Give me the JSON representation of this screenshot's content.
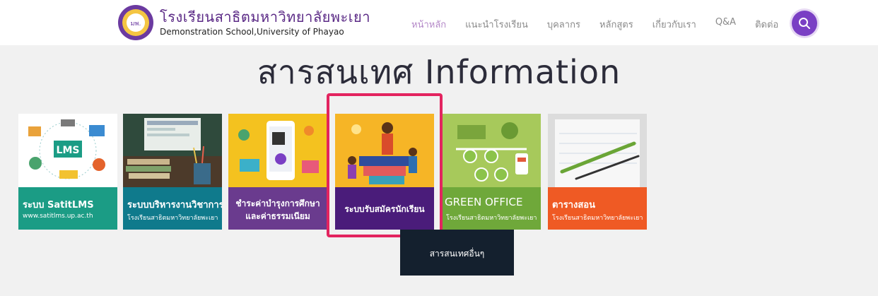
{
  "header": {
    "school_name_th": "โรงเรียนสาธิตมหาวิทยาลัยพะเยา",
    "school_name_en": "Demonstration School,University of Phayao",
    "seal_icon": "school-seal-icon",
    "seal_text": "มพ."
  },
  "nav": {
    "items": [
      "หน้าหลัก",
      "แนะนำโรงเรียน",
      "บุคลากร",
      "หลักสูตร",
      "เกี่ยวกับเรา",
      "Q&A",
      "ติดต่อ"
    ],
    "active_index": 0,
    "search_icon": "search-icon"
  },
  "page_title": "สารสนเทศ Information",
  "cards": [
    {
      "title": "ระบบ SatitLMS",
      "subtitle": "www.satitlms.up.ac.th",
      "caption_color": "#1b9c85"
    },
    {
      "title": "ระบบบริหารงานวิชาการ",
      "subtitle": "โรงเรียนสาธิตมหาวิทยาลัยพะเยา",
      "caption_color": "#0f7a8c"
    },
    {
      "title_line1": "ชำระค่าบำรุงการศึกษา",
      "title_line2": "และค่าธรรมเนียม",
      "caption_color": "#6a3b8e"
    },
    {
      "title": "ระบบรับสมัครนักเรียน",
      "caption_color": "#4a1c7a",
      "highlighted": true
    },
    {
      "title": "GREEN OFFICE",
      "subtitle": "โรงเรียนสาธิตมหาวิทยาลัยพะเยา",
      "caption_color": "#6fa83a"
    },
    {
      "title": "ตารางสอน",
      "subtitle": "โรงเรียนสาธิตมหาวิทยาลัยพะเยา",
      "caption_color": "#ef5a24"
    }
  ],
  "more_button": "สารสนเทศอื่นๆ",
  "colors": {
    "brand_purple": "#7a3fc4",
    "highlight_border": "#e3245f",
    "title_text": "#2c2c3a",
    "more_button_bg": "#14202e"
  }
}
